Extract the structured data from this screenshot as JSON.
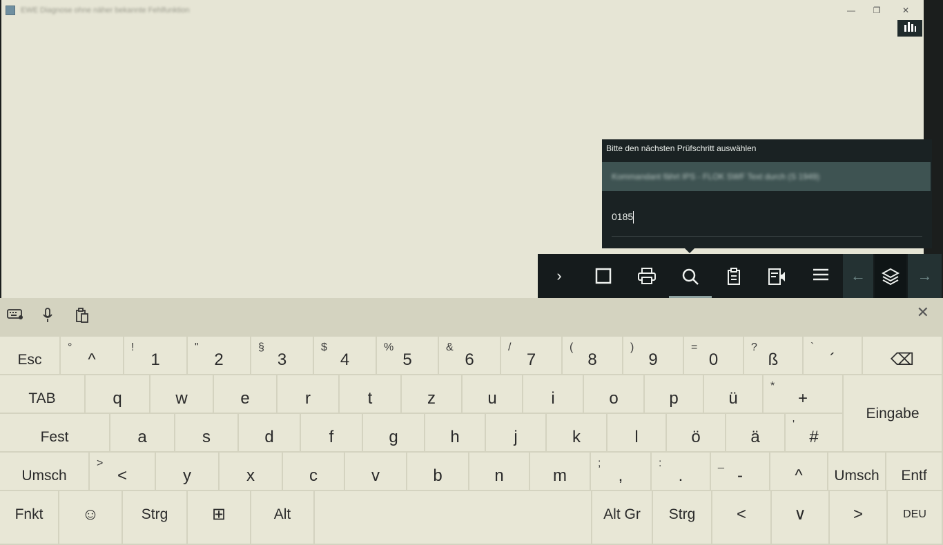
{
  "window": {
    "title": "EWE Diagnose ohne näher bekannte Fehlfunktion",
    "controls": [
      "—",
      "❐",
      "✕"
    ]
  },
  "dialog": {
    "title": "Bitte den nächsten Prüfschritt auswählen",
    "option": "Kommandant fährt IPS - FLOK SWF Text durch (S 1949)",
    "input_value": "0185"
  },
  "toolbar": {
    "items": [
      {
        "name": "collapse-chevron-icon",
        "glyph": "›"
      },
      {
        "name": "square-icon",
        "glyph": "☐"
      },
      {
        "name": "print-icon",
        "glyph": "⎙"
      },
      {
        "name": "search-icon",
        "glyph": "⌕"
      },
      {
        "name": "clipboard-icon",
        "glyph": "📋"
      },
      {
        "name": "document-audio-icon",
        "glyph": "🗎"
      },
      {
        "name": "menu-icon",
        "glyph": "☰"
      },
      {
        "name": "back-arrow-icon",
        "glyph": "←"
      },
      {
        "name": "layers-icon",
        "glyph": "⧉"
      },
      {
        "name": "forward-arrow-icon",
        "glyph": "→"
      }
    ]
  },
  "keyboard": {
    "row1": [
      {
        "label": "Esc"
      },
      {
        "sub": "°",
        "label": "^"
      },
      {
        "sub": "!",
        "label": "1"
      },
      {
        "sub": "\"",
        "label": "2"
      },
      {
        "sub": "§",
        "label": "3"
      },
      {
        "sub": "$",
        "label": "4"
      },
      {
        "sub": "%",
        "label": "5"
      },
      {
        "sub": "&",
        "label": "6"
      },
      {
        "sub": "/",
        "label": "7"
      },
      {
        "sub": "(",
        "label": "8"
      },
      {
        "sub": ")",
        "label": "9"
      },
      {
        "sub": "=",
        "label": "0"
      },
      {
        "sub": "?",
        "label": "ß"
      },
      {
        "sub": "`",
        "label": "´"
      },
      {
        "label": "⌫"
      }
    ],
    "row2": [
      {
        "label": "TAB"
      },
      {
        "label": "q"
      },
      {
        "label": "w"
      },
      {
        "label": "e"
      },
      {
        "label": "r"
      },
      {
        "label": "t"
      },
      {
        "label": "z"
      },
      {
        "label": "u"
      },
      {
        "label": "i"
      },
      {
        "label": "o"
      },
      {
        "label": "p"
      },
      {
        "label": "ü"
      },
      {
        "sub": "*",
        "label": "+"
      },
      {
        "label": "Eingabe"
      }
    ],
    "row3": [
      {
        "label": "Fest"
      },
      {
        "label": "a"
      },
      {
        "label": "s"
      },
      {
        "label": "d"
      },
      {
        "label": "f"
      },
      {
        "label": "g"
      },
      {
        "label": "h"
      },
      {
        "label": "j"
      },
      {
        "label": "k"
      },
      {
        "label": "l"
      },
      {
        "label": "ö"
      },
      {
        "label": "ä"
      },
      {
        "sub": "'",
        "label": "#"
      }
    ],
    "row4": [
      {
        "label": "Umsch"
      },
      {
        "sub": ">",
        "label": "<"
      },
      {
        "label": "y"
      },
      {
        "label": "x"
      },
      {
        "label": "c"
      },
      {
        "label": "v"
      },
      {
        "label": "b"
      },
      {
        "label": "n"
      },
      {
        "label": "m"
      },
      {
        "sub": ";",
        "label": ","
      },
      {
        "sub": ":",
        "label": "."
      },
      {
        "sub": "_",
        "label": "-"
      },
      {
        "label": "^"
      },
      {
        "label": "Umsch"
      },
      {
        "label": "Entf"
      }
    ],
    "row5": [
      {
        "label": "Fnkt"
      },
      {
        "label": "☺"
      },
      {
        "label": "Strg"
      },
      {
        "label": "⊞"
      },
      {
        "label": "Alt"
      },
      {
        "label": ""
      },
      {
        "label": "Alt Gr"
      },
      {
        "label": "Strg"
      },
      {
        "label": "<"
      },
      {
        "label": "∨"
      },
      {
        "label": ">"
      },
      {
        "label": "DEU"
      }
    ]
  }
}
